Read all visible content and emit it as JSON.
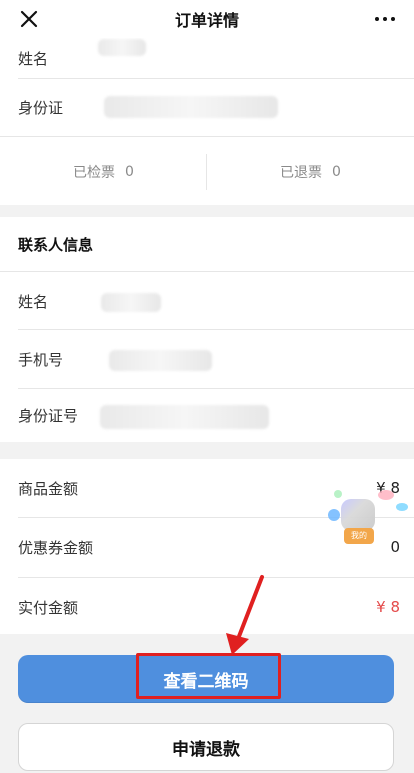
{
  "nav": {
    "title": "订单详情",
    "close_icon": "close-icon",
    "more_icon": "more-icon"
  },
  "visitor": {
    "name_label": "姓名",
    "id_label": "身份证"
  },
  "ticket_stats": {
    "checked_label": "已检票",
    "checked_value": "0",
    "refunded_label": "已退票",
    "refunded_value": "0"
  },
  "contact": {
    "section_title": "联系人信息",
    "name_label": "姓名",
    "phone_label": "手机号",
    "id_label": "身份证号"
  },
  "amounts": {
    "goods_label": "商品金额",
    "goods_value": "¥ 8",
    "coupon_label": "优惠券金额",
    "coupon_value": "0",
    "paid_label": "实付金额",
    "paid_value": "¥ 8"
  },
  "floating_widget": {
    "chip_text": "我的"
  },
  "buttons": {
    "view_qr": "查看二维码",
    "refund": "申请退款"
  },
  "colors": {
    "primary": "#4f8fde",
    "highlight": "#e02020",
    "price_red": "#e44b4b"
  }
}
